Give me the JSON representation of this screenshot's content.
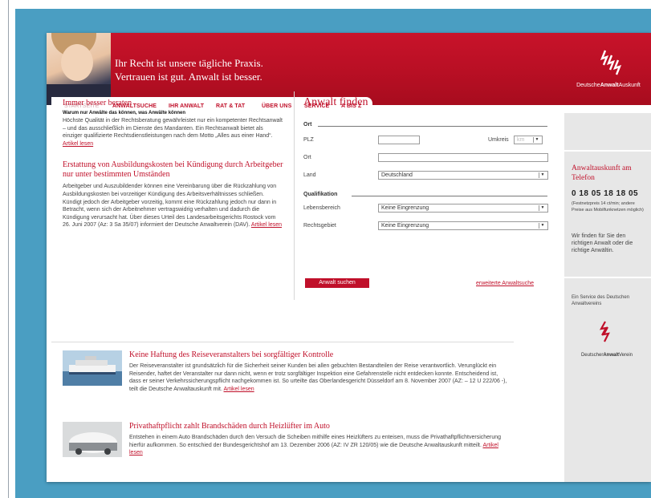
{
  "header": {
    "slogan_line1": "Ihr Recht ist unsere tägliche Praxis.",
    "slogan_line2": "Vertrauen ist gut. Anwalt ist besser.",
    "logo_text_prefix": "Deutsche",
    "logo_text_bold": "Anwalt",
    "logo_text_suffix": "Auskunft"
  },
  "nav": {
    "items": [
      {
        "label": "STARTSEITE"
      },
      {
        "label": "ANWALTSUCHE"
      },
      {
        "label": "IHR ANWALT"
      },
      {
        "label": "RAT & TAT"
      },
      {
        "label": "ÜBER UNS"
      },
      {
        "label": "SERVICE"
      },
      {
        "label": "A BIS Z"
      }
    ]
  },
  "left": {
    "art1": {
      "title": "Immer besser beraten",
      "subtitle": "Warum nur Anwälte das können, was Anwälte können",
      "text": "Höchste Qualität in der Rechtsberatung gewährleistet nur ein kompetenter Rechtsanwalt – und das ausschließlich im Dienste des Mandanten. Ein Rechtsanwalt bietet als einziger qualifizierte Rechtsdienstleistungen nach dem Motto „Alles aus einer Hand“.",
      "link": "Artikel lesen"
    },
    "art2": {
      "title": "Erstattung von Ausbildungskosten bei Kündigung durch Arbeitgeber nur unter bestimmten Umständen",
      "text": "Arbeitgeber und Auszubildender können eine Vereinbarung über die Rückzahlung von Ausbildungskosten bei vorzeitiger Kündigung des Arbeitsverhältnisses schließen. Kündigt jedoch der Arbeitgeber vorzeitig, kommt eine Rückzahlung jedoch nur dann in Betracht, wenn sich der Arbeitnehmer vertragswidrig verhalten und dadurch die Kündigung verursacht hat. Über dieses Urteil des Landesarbeitsgerichts Rostock vom 26. Juni 2007 (Az: 3 Sa 35/07) informiert der Deutsche Anwaltverein (DAV).",
      "link": "Artikel lesen"
    }
  },
  "form": {
    "title": "Anwalt finden",
    "group_ort": "Ort",
    "plz_label": "PLZ",
    "plz_value": "",
    "umkreis_label": "Umkreis",
    "umkreis_value": "km",
    "ort_label": "Ort",
    "ort_value": "",
    "land_label": "Land",
    "land_value": "Deutschland",
    "group_quali": "Qualifikation",
    "lebens_label": "Lebensbereich",
    "lebens_value": "Keine Eingrenzung",
    "rechts_label": "Rechtsgebiet",
    "rechts_value": "Keine Eingrenzung",
    "submit": "Anwalt suchen",
    "advanced": "erweiterte Anwaltsuche"
  },
  "sidebar": {
    "title": "Anwaltauskunft am Telefon",
    "phone": "0 18 05 18 18 05",
    "phone_note": "(Festnetzpreis 14 ct/min; andere Preise aus Mobilfunknetzen möglich)",
    "text": "Wir finden für Sie den richtigen Anwalt oder die richtige Anwältin.",
    "service": "Ein Service des Deutschen Anwaltvereins",
    "dav_prefix": "Deutscher",
    "dav_bold": "Anwalt",
    "dav_suffix": "Verein"
  },
  "articles": [
    {
      "title": "Keine Haftung des Reiseveranstalters bei sorgfältiger Kontrolle",
      "text": "Der Reiseveranstalter ist grundsätzlich für die Sicherheit seiner Kunden bei allen gebuchten Bestandteilen der Reise verantwortlich. Verunglückt ein Reisender, haftet der Veranstalter nur dann nicht, wenn er trotz sorgfältiger Inspektion eine Gefahrenstelle nicht entdecken konnte. Entscheidend ist, dass er seiner Verkehrssicherungspflicht nachgekommen ist. So urteilte das Oberlandesgericht Düsseldorf am 8. November 2007 (AZ: – 12 U 222/06 -), teilt die Deutsche Anwaltauskunft mit.",
      "link": "Artikel lesen"
    },
    {
      "title": "Privathaftpflicht zahlt Brandschäden durch Heizlüfter im Auto",
      "text": "Entstehen in einem Auto Brandschäden durch den Versuch die Scheiben mithilfe eines Heizlüfters zu enteisen, muss die Privathaftpflichtversicherung hierfür aufkommen. So entschied der Bundesgerichtshof am 13. Dezember 2006 (AZ: IV ZR 120/05) wie die Deutsche Anwaltauskunft mitteilt.",
      "link": "Artikel lesen"
    }
  ],
  "colors": {
    "brand_red": "#c0102a",
    "background_blue": "#4a9ec2",
    "sidebar_grey": "#e7e7e7"
  }
}
